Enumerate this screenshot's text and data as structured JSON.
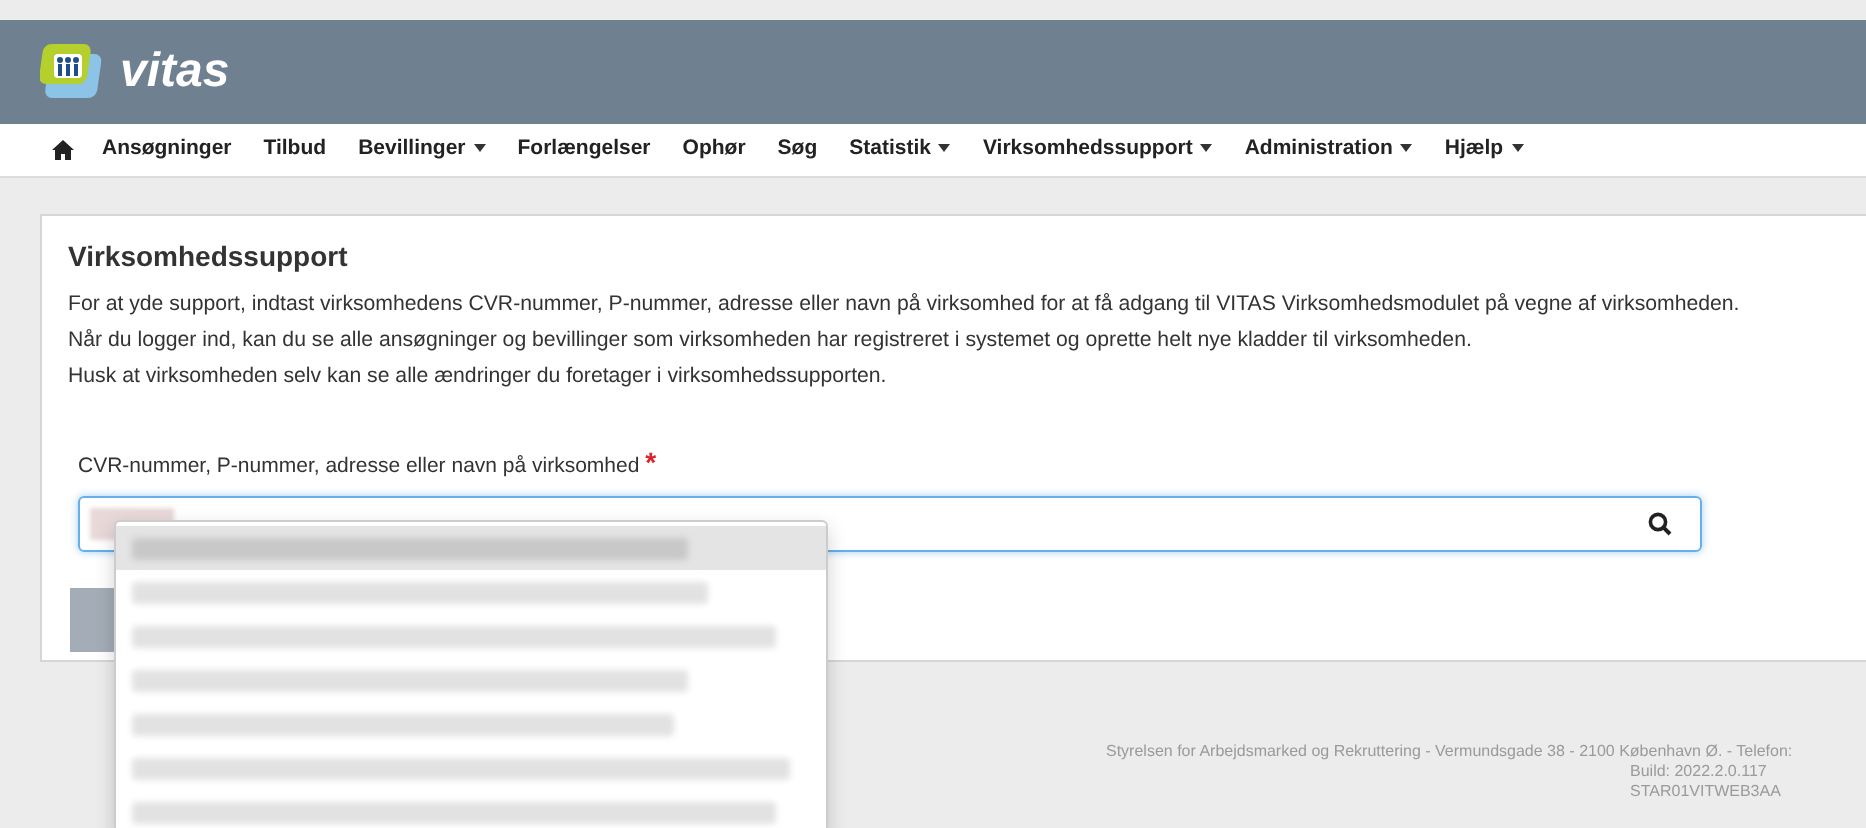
{
  "brand": {
    "name": "vitas"
  },
  "nav": [
    {
      "label": "Ansøgninger",
      "dropdown": false
    },
    {
      "label": "Tilbud",
      "dropdown": false
    },
    {
      "label": "Bevillinger",
      "dropdown": true
    },
    {
      "label": "Forlængelser",
      "dropdown": false
    },
    {
      "label": "Ophør",
      "dropdown": false
    },
    {
      "label": "Søg",
      "dropdown": false
    },
    {
      "label": "Statistik",
      "dropdown": true
    },
    {
      "label": "Virksomhedssupport",
      "dropdown": true
    },
    {
      "label": "Administration",
      "dropdown": true
    },
    {
      "label": "Hjælp",
      "dropdown": true
    }
  ],
  "panel": {
    "title": "Virksomhedssupport",
    "paragraphs": [
      "For at yde support, indtast virksomhedens CVR-nummer, P-nummer, adresse eller navn på virksomhed for at få adgang til VITAS Virksomhedsmodulet på vegne af virksomheden.",
      "Når du logger ind, kan du se alle ansøgninger og bevillinger som virksomheden har registreret i systemet og oprette helt nye kladder til virksomheden.",
      "Husk at virksomheden selv kan se alle ændringer du foretager i virksomhedssupporten."
    ],
    "field": {
      "label": "CVR-nummer, P-nummer, adresse eller navn på virksomhed",
      "required_mark": "*"
    },
    "suggestions": [
      {
        "selected": true
      },
      {
        "selected": false
      },
      {
        "selected": false
      },
      {
        "selected": false
      },
      {
        "selected": false
      },
      {
        "selected": false
      },
      {
        "selected": false
      }
    ]
  },
  "footer": [
    "Styrelsen for Arbejdsmarked og Rekruttering - Vermundsgade 38 - 2100 København Ø. - Telefon:",
    "Build: 2022.2.0.117",
    "STAR01VITWEB3AA"
  ]
}
